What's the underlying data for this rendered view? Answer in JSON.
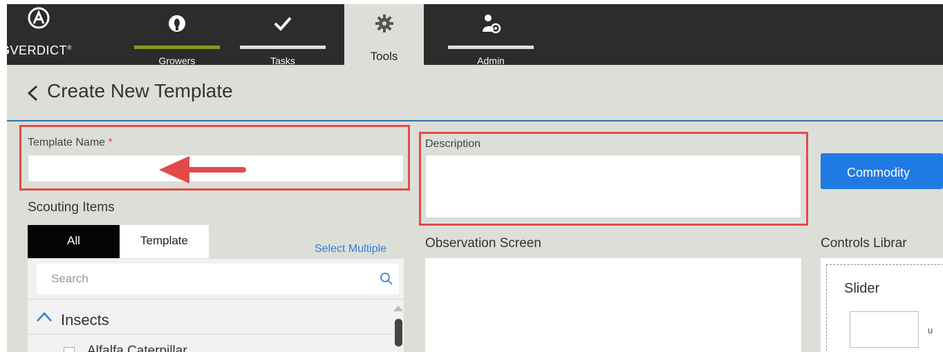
{
  "nav": {
    "logo_text_bold": "G",
    "logo_text_rest": "VERDICT",
    "logo_trademark": "®",
    "tabs": [
      {
        "label": "Growers",
        "icon": "grower-icon",
        "bar_color": "#8a9a1c"
      },
      {
        "label": "Tasks",
        "icon": "checkmark-icon",
        "bar_color": "#dddddd"
      },
      {
        "label": "Tools",
        "icon": "gear-icon",
        "active": true
      },
      {
        "label": "Admin",
        "icon": "admin-user-gear-icon",
        "bar_color": "#dddddd"
      }
    ]
  },
  "header": {
    "title": "Create New Template"
  },
  "form": {
    "template_name_label": "Template Name",
    "required_marker": "*",
    "template_name_value": "",
    "description_label": "Description",
    "description_value": "",
    "commodity_button": "Commodity"
  },
  "scouting": {
    "label": "Scouting Items",
    "filter_all": "All",
    "filter_template": "Template",
    "select_multiple": "Select Multiple",
    "search_placeholder": "Search",
    "group": "Insects",
    "items": [
      "Alfalfa Caterpillar"
    ]
  },
  "observation": {
    "label": "Observation Screen"
  },
  "controls": {
    "label": "Controls Librar",
    "slider_title": "Slider",
    "slider_unit": "u"
  },
  "colors": {
    "accent": "#1f7be3",
    "highlight": "#e24a4a",
    "nav_bg": "#2c2c2c",
    "grower_bar": "#8a9a1c"
  }
}
